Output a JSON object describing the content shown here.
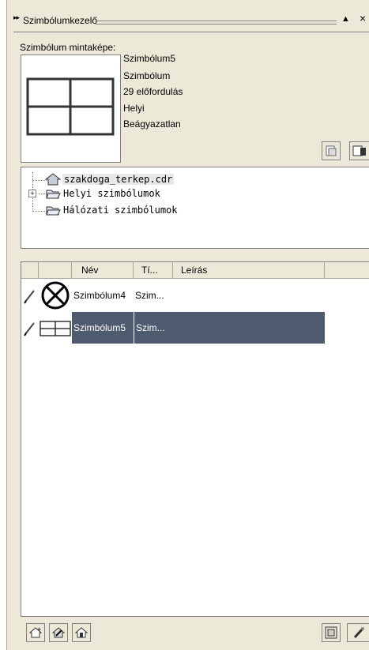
{
  "titlebar": {
    "arrows": "▸▸",
    "title": "Szimbólumkezelő",
    "menu_arrow": "▲",
    "close": "×"
  },
  "preview": {
    "label": "Szimbólum mintaképe:",
    "name": "Szimbólum5",
    "type": "Szimbólum",
    "occurrences": "29 előfordulás",
    "scope": "Helyi",
    "embedding": "Beágyazatlan"
  },
  "tree": {
    "items": [
      {
        "label": "szakdoga_terkep.cdr",
        "icon": "home-icon"
      },
      {
        "label": "Helyi szimbólumok",
        "icon": "folder-icon",
        "expand": "+"
      },
      {
        "label": "Hálózati szimbólumok",
        "icon": "folder-icon"
      }
    ]
  },
  "list": {
    "columns": [
      "Név",
      "Tí...",
      "Leírás"
    ],
    "rows": [
      {
        "name": "Szimbólum4",
        "type": "Szim...",
        "description": "",
        "selected": false,
        "thumb": "wheel-icon"
      },
      {
        "name": "Szimbólum5",
        "type": "Szim...",
        "description": "",
        "selected": true,
        "thumb": "cross-grid-icon"
      }
    ]
  }
}
